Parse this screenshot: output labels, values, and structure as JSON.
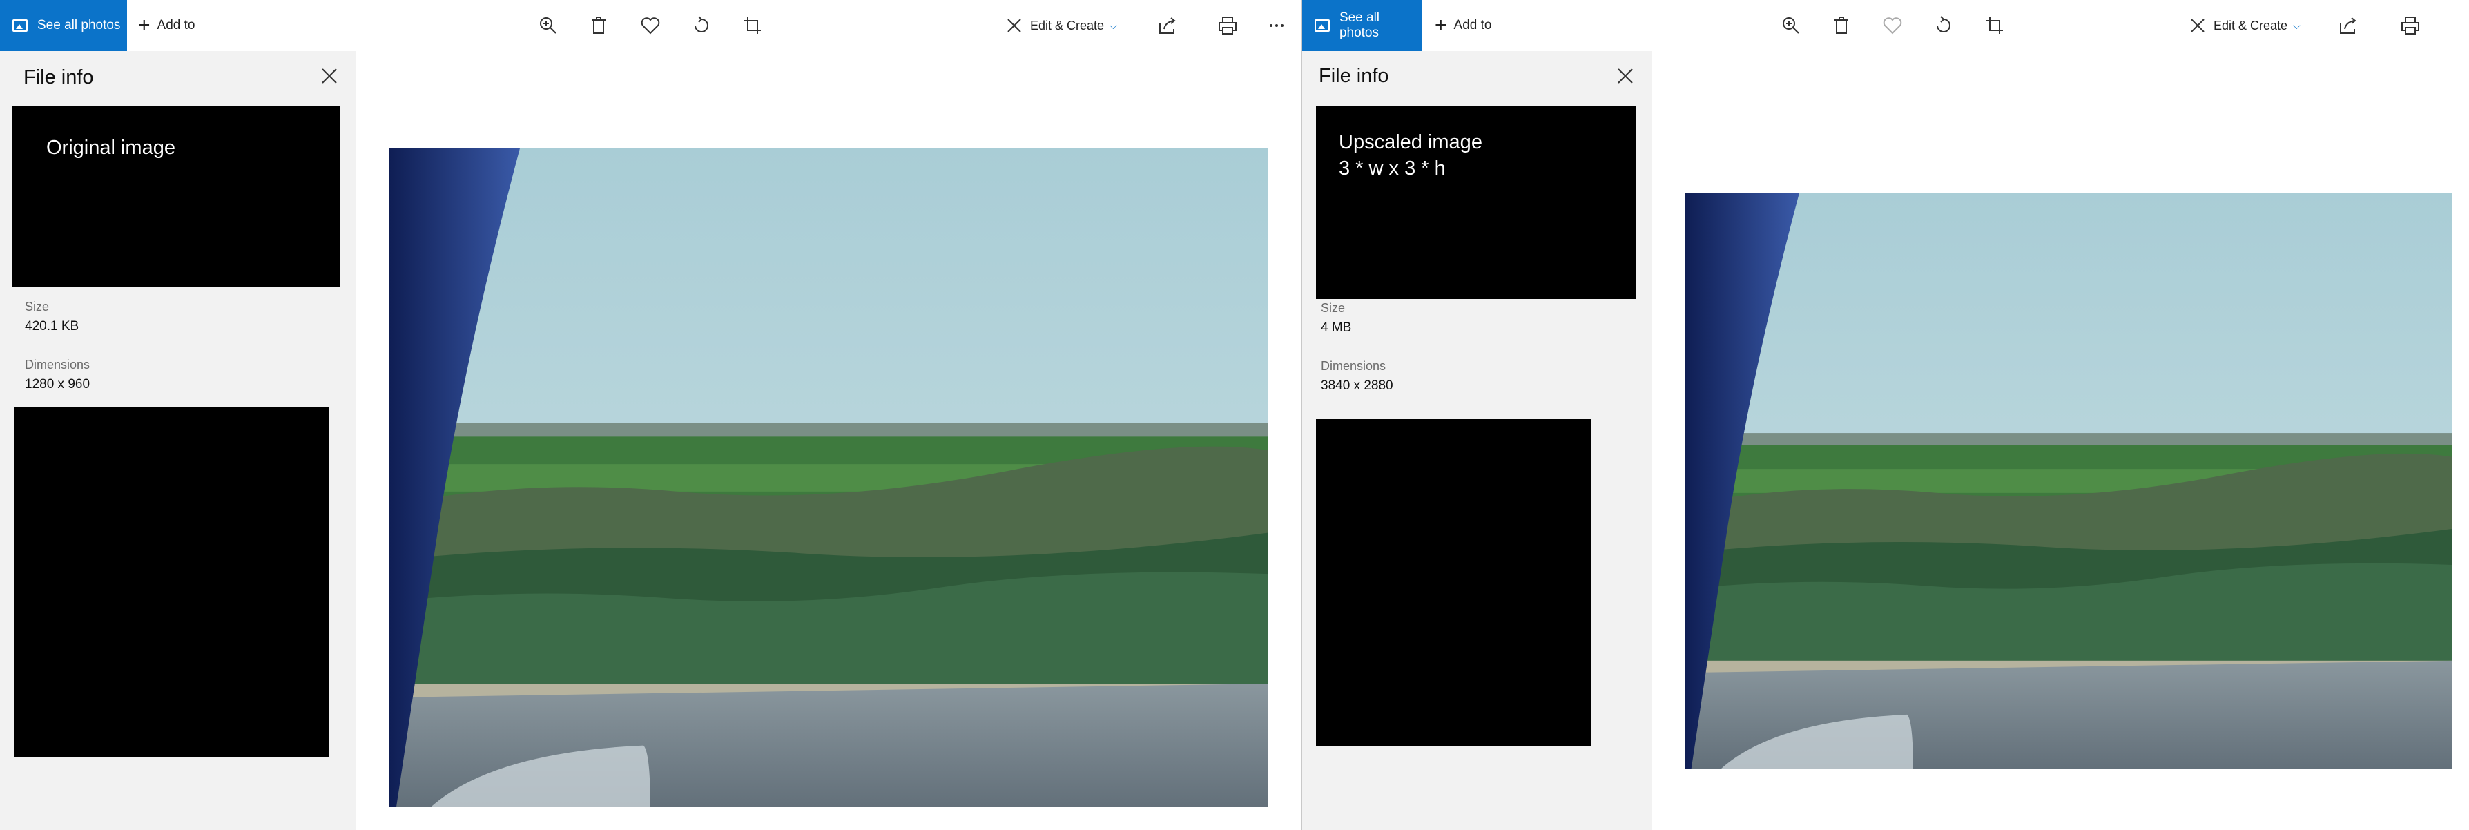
{
  "toolbar": {
    "see_all_photos": "See all photos",
    "add_to": "Add to",
    "edit_create": "Edit & Create",
    "icons": [
      "zoom-in-icon",
      "delete-icon",
      "favorite-icon",
      "rotate-icon",
      "crop-icon",
      "edit-create-icon",
      "share-icon",
      "print-icon",
      "more-icon"
    ]
  },
  "left": {
    "panel_title": "File info",
    "preview_label": "Original image",
    "size_label": "Size",
    "size_value": "420.1 KB",
    "dimensions_label": "Dimensions",
    "dimensions_value": "1280 x 960"
  },
  "right": {
    "panel_title": "File info",
    "preview_label": "Upscaled image\n3 * w x 3 * h",
    "size_label": "Size",
    "size_value": "4 MB",
    "dimensions_label": "Dimensions",
    "dimensions_value": "3840 x 2880"
  },
  "colors": {
    "accent": "#0b73c9",
    "panel_bg": "#f2f2f2"
  }
}
